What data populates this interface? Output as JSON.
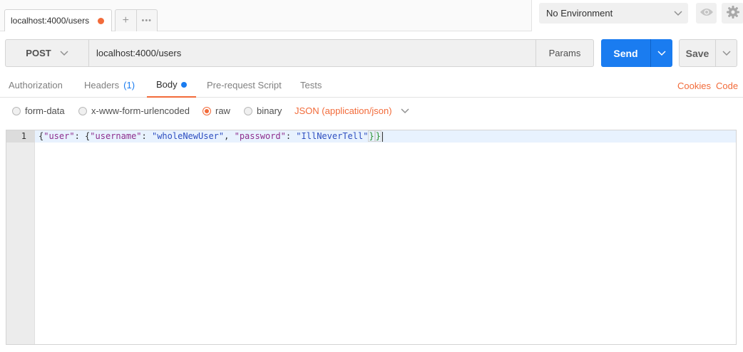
{
  "tabs": {
    "active_tab_label": "localhost:4000/users",
    "add_symbol": "+",
    "more_symbol": "•••",
    "unsaved_color": "#f26b3a"
  },
  "environment": {
    "selected": "No Environment",
    "eye_icon": "eye-icon",
    "settings_icon": "gear-icon"
  },
  "request": {
    "method": "POST",
    "url": "localhost:4000/users",
    "params_label": "Params",
    "send_label": "Send",
    "save_label": "Save"
  },
  "subtabs": {
    "authorization": "Authorization",
    "headers": "Headers",
    "headers_count": "(1)",
    "body": "Body",
    "pre_request": "Pre-request Script",
    "tests": "Tests",
    "cookies": "Cookies",
    "code": "Code"
  },
  "body_types": {
    "form_data": "form-data",
    "urlencoded": "x-www-form-urlencoded",
    "raw": "raw",
    "binary": "binary",
    "selected": "raw",
    "content_type": "JSON (application/json)"
  },
  "editor": {
    "line_number": "1",
    "tokens": {
      "open1": "{",
      "key_user": "\"user\"",
      "colon1": ": ",
      "open2": "{",
      "key_username": "\"username\"",
      "colon2": ": ",
      "val_username": "\"wholeNewUser\"",
      "comma": ", ",
      "key_password": "\"password\"",
      "colon3": ": ",
      "val_password": "\"IllNeverTell\"",
      "close2": "}",
      "close1": "}"
    }
  },
  "colors": {
    "accent": "#f26b3a",
    "primary": "#1a7cf0"
  }
}
